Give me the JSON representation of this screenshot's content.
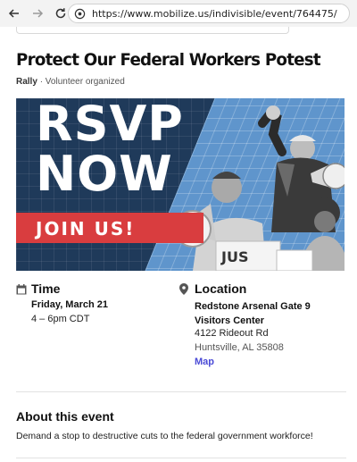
{
  "browser": {
    "url": "https://www.mobilize.us/indivisible/event/764475/",
    "icons": [
      "back-arrow-icon",
      "forward-arrow-icon",
      "reload-icon",
      "site-info-icon"
    ]
  },
  "event": {
    "title": "Protect Our Federal Workers Potest",
    "type": "Rally",
    "organizer_note": "· Volunteer organized"
  },
  "hero": {
    "line1": "RSVP",
    "line2": "NOW",
    "banner": "JOIN US!",
    "colors": {
      "navy": "#1f3a5a",
      "light_blue": "#5f95cc",
      "red": "#d93d3f"
    }
  },
  "time": {
    "heading": "Time",
    "date": "Friday, March 21",
    "hours": "4 – 6pm CDT",
    "icon": "calendar-icon"
  },
  "location": {
    "heading": "Location",
    "name": "Redstone Arsenal Gate 9 Visitors Center",
    "street": "4122 Rideout Rd",
    "city": "Huntsville, AL 35808",
    "map_link": "Map",
    "icon": "map-pin-icon"
  },
  "about": {
    "heading": "About this event",
    "text": "Demand a stop to destructive cuts to the federal government workforce!"
  }
}
